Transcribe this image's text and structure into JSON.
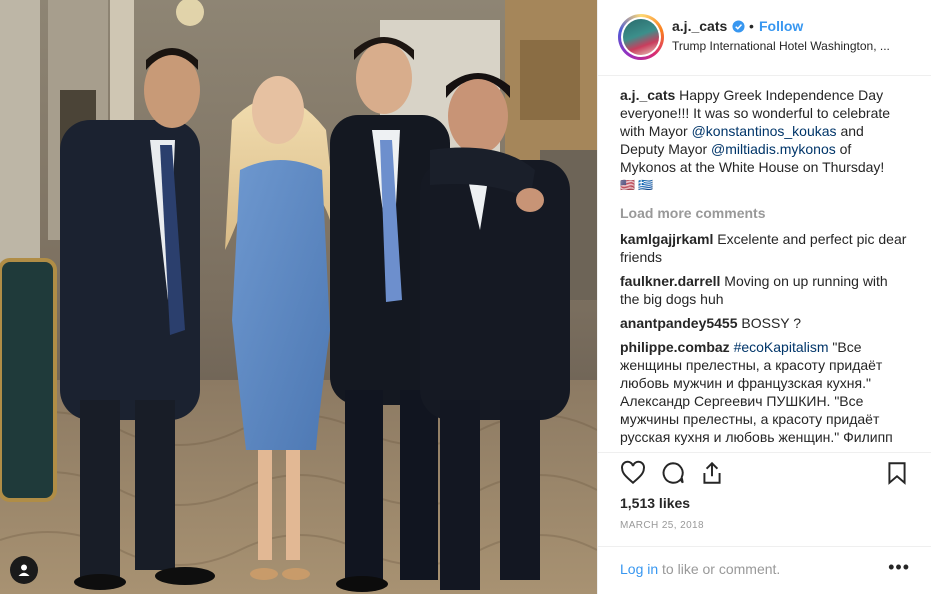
{
  "post": {
    "username": "a.j._cats",
    "follow_label": "Follow",
    "dot": "•",
    "location": "Trump International Hotel Washington, ...",
    "caption": {
      "username": "a.j._cats",
      "text_1": "Happy Greek Independence Day everyone!!! It was so wonderful to celebrate with Mayor",
      "mention_1": "@konstantinos_koukas",
      "text_2": "and Deputy Mayor",
      "mention_2": "@miltiadis.mykonos",
      "text_3": "of Mykonos at the White House on Thursday!",
      "flags": "🇺🇸 🇬🇷"
    },
    "load_more": "Load more comments",
    "comments": [
      {
        "user": "kamlgajjrkaml",
        "text": "Excelente and perfect pic dear friends"
      },
      {
        "user": "faulkner.darrell",
        "text": "Moving on up running with the big dogs huh"
      },
      {
        "user": "anantpandey5455",
        "text": "BOSSY ?"
      }
    ],
    "last_comment": {
      "user": "philippe.combaz",
      "hashtag": "#ecoKapitalism",
      "text": "\"Все женщины прелестны, а красоту придаёт любовь мужчин и французская кухня.\" Александр Сергеевич ПУШКИН. \"Все мужчины прелестны, а красоту придаёт русская кухня и любовь женщин.\" Филипп"
    },
    "likes": "1,513 likes",
    "date": "MARCH 25, 2018",
    "login_link": "Log in",
    "login_rest": "to like or comment.",
    "more_label": "•••"
  },
  "icons": {
    "like": "heart-icon",
    "comment": "comment-icon",
    "share": "share-icon",
    "save": "bookmark-icon",
    "verified": "verified-badge-icon",
    "tag": "user-tag-icon"
  },
  "colors": {
    "link_blue": "#3897f0",
    "mention_dark": "#003569",
    "muted_gray": "#999999",
    "verified_blue": "#3897f0"
  }
}
